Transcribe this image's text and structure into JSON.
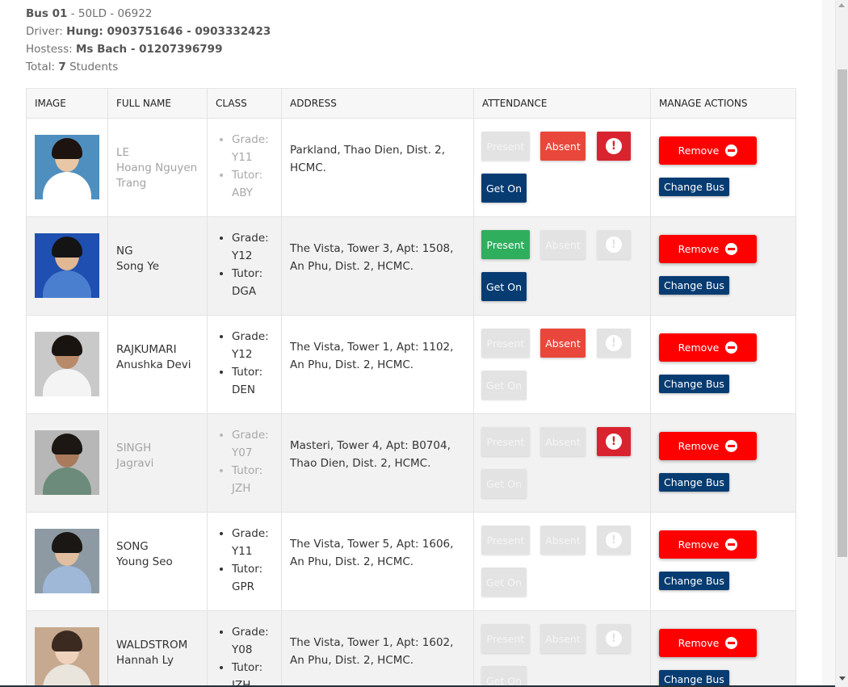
{
  "bus": {
    "label": "Bus 01",
    "plate": " - 50LD - 06922",
    "driver_label": "Driver: ",
    "driver": "Hung: 0903751646 - 0903332423",
    "hostess_label": "Hostess: ",
    "hostess": "Ms Bach - 01207396799",
    "total_label": "Total: ",
    "total_count": "7",
    "total_suffix": " Students"
  },
  "table": {
    "headers": [
      "IMAGE",
      "FULL NAME",
      "CLASS",
      "ADDRESS",
      "ATTENDANCE",
      "MANAGE ACTIONS"
    ]
  },
  "buttons": {
    "present": "Present",
    "absent": "Absent",
    "get_on": "Get On",
    "remove": "Remove",
    "change_bus": "Change Bus",
    "alert_glyph": "!"
  },
  "icons": {
    "alert": "exclamation-circle-icon",
    "remove": "minus-circle-icon"
  },
  "colors": {
    "present_active": "#2fae5d",
    "absent_active": "#e9473b",
    "alert_active": "#d9232e",
    "get_on_active": "#073c72",
    "remove": "#ff0000",
    "inactive": "#e3e3e3"
  },
  "students": [
    {
      "last": "LE",
      "first": "Hoang Nguyen Trang",
      "grade_label": "Grade:",
      "grade": "Y11",
      "tutor_label": "Tutor:",
      "tutor": "ABY",
      "address": "Parkland, Thao Dien, Dist. 2, HCMC.",
      "present": false,
      "absent": true,
      "alert": true,
      "get_on": true,
      "dim": true
    },
    {
      "last": "NG",
      "first": "Song Ye",
      "grade_label": "Grade:",
      "grade": "Y12",
      "tutor_label": "Tutor:",
      "tutor": "DGA",
      "address": "The Vista, Tower 3, Apt: 1508, An Phu, Dist. 2, HCMC.",
      "present": true,
      "absent": false,
      "alert": false,
      "get_on": true,
      "dim": false
    },
    {
      "last": "RAJKUMARI",
      "first": "Anushka Devi",
      "grade_label": "Grade:",
      "grade": "Y12",
      "tutor_label": "Tutor:",
      "tutor": "DEN",
      "address": "The Vista, Tower 1, Apt: 1102, An Phu, Dist. 2, HCMC.",
      "present": false,
      "absent": true,
      "alert": false,
      "get_on": false,
      "dim": false
    },
    {
      "last": "SINGH",
      "first": "Jagravi",
      "grade_label": "Grade:",
      "grade": "Y07",
      "tutor_label": "Tutor:",
      "tutor": "JZH",
      "address": "Masteri, Tower 4, Apt: B0704, Thao Dien, Dist. 2, HCMC.",
      "present": false,
      "absent": false,
      "alert": true,
      "get_on": false,
      "dim": true
    },
    {
      "last": "SONG",
      "first": "Young Seo",
      "grade_label": "Grade:",
      "grade": "Y11",
      "tutor_label": "Tutor:",
      "tutor": "GPR",
      "address": "The Vista, Tower 5, Apt: 1606, An Phu, Dist. 2, HCMC.",
      "present": false,
      "absent": false,
      "alert": false,
      "get_on": false,
      "dim": false
    },
    {
      "last": "WALDSTROM",
      "first": "Hannah Ly",
      "grade_label": "Grade:",
      "grade": "Y08",
      "tutor_label": "Tutor:",
      "tutor": "JZH",
      "address": "The Vista, Tower 1, Apt: 1602, An Phu, Dist. 2, HCMC.",
      "present": false,
      "absent": false,
      "alert": false,
      "get_on": false,
      "dim": false
    }
  ]
}
